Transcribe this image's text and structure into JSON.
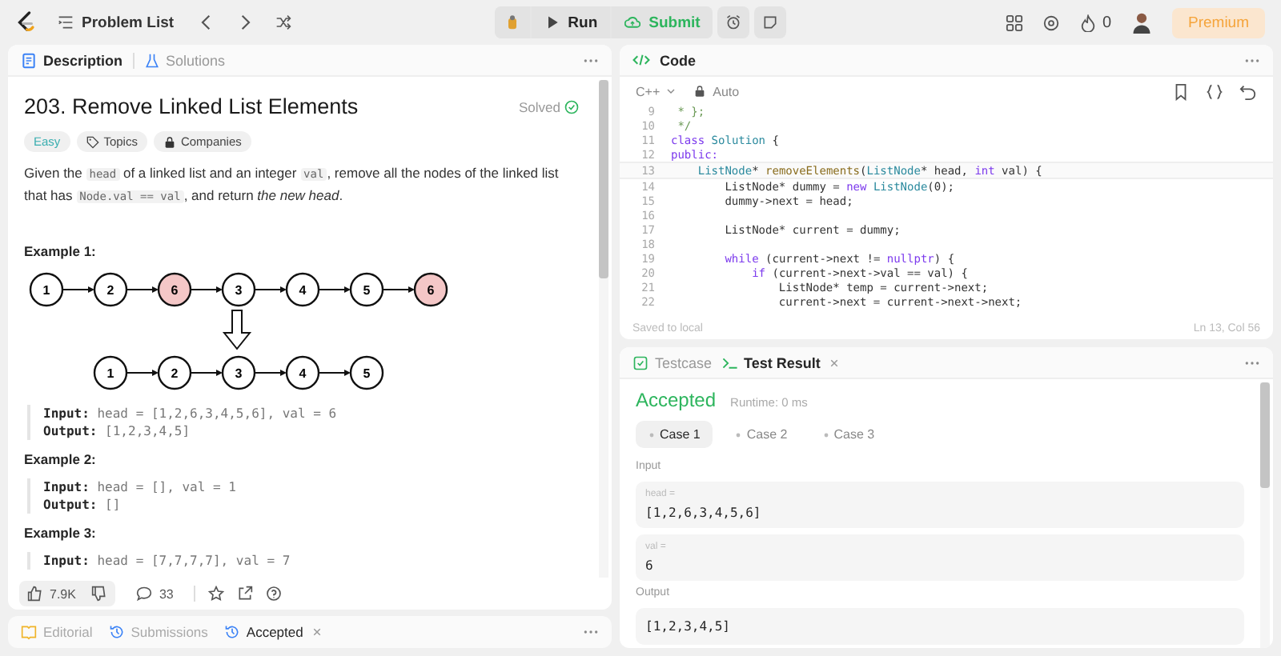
{
  "topbar": {
    "problem_list": "Problem List",
    "run": "Run",
    "submit": "Submit",
    "streak": "0",
    "premium": "Premium"
  },
  "description_panel": {
    "tabs": [
      {
        "label": "Description",
        "selected": true
      },
      {
        "label": "Solutions",
        "selected": false
      }
    ],
    "title": "203. Remove Linked List Elements",
    "status": "Solved",
    "tags": [
      {
        "label": "Easy",
        "kind": "difficulty"
      },
      {
        "label": "Topics",
        "kind": "topics"
      },
      {
        "label": "Companies",
        "kind": "companies"
      }
    ],
    "statement": [
      {
        "text": "Given the ",
        "kind": "text"
      },
      {
        "text": "head",
        "kind": "code"
      },
      {
        "text": " of a linked list and an integer ",
        "kind": "text"
      },
      {
        "text": "val",
        "kind": "code"
      },
      {
        "text": ", remove all the nodes of the linked list that has ",
        "kind": "text"
      },
      {
        "text": "Node.val == val",
        "kind": "code"
      },
      {
        "text": ", and return ",
        "kind": "text"
      },
      {
        "text": "the new head",
        "kind": "em"
      },
      {
        "text": ".",
        "kind": "text"
      }
    ],
    "examples": [
      {
        "heading": "Example 1:",
        "diagram": {
          "top_row": [
            {
              "label": "1",
              "removed": false
            },
            {
              "label": "2",
              "removed": false
            },
            {
              "label": "6",
              "removed": true
            },
            {
              "label": "3",
              "removed": false
            },
            {
              "label": "4",
              "removed": false
            },
            {
              "label": "5",
              "removed": false
            },
            {
              "label": "6",
              "removed": true
            }
          ],
          "bottom_row": [
            {
              "label": "1",
              "removed": false
            },
            {
              "label": "2",
              "removed": false
            },
            {
              "label": "3",
              "removed": false
            },
            {
              "label": "4",
              "removed": false
            },
            {
              "label": "5",
              "removed": false
            }
          ]
        },
        "lines": [
          {
            "label": "Input:",
            "value": "head = [1,2,6,3,4,5,6], val = 6"
          },
          {
            "label": "Output:",
            "value": "[1,2,3,4,5]"
          }
        ]
      },
      {
        "heading": "Example 2:",
        "lines": [
          {
            "label": "Input:",
            "value": "head = [], val = 1"
          },
          {
            "label": "Output:",
            "value": "[]"
          }
        ]
      },
      {
        "heading": "Example 3:",
        "lines": [
          {
            "label": "Input:",
            "value": "head = [7,7,7,7], val = 7"
          }
        ]
      }
    ],
    "actions": {
      "likes": "7.9K",
      "comments": "33"
    },
    "bottom_tabs": [
      {
        "label": "Editorial",
        "selected": false,
        "closable": false
      },
      {
        "label": "Submissions",
        "selected": false,
        "closable": false
      },
      {
        "label": "Accepted",
        "selected": true,
        "closable": true
      }
    ]
  },
  "code_panel": {
    "title": "Code",
    "language": "C++",
    "mode": "Auto",
    "lines": [
      {
        "num": "9",
        "segs": [
          {
            "text": " * };",
            "kind": "comment"
          }
        ]
      },
      {
        "num": "10",
        "segs": [
          {
            "text": " */",
            "kind": "comment"
          }
        ]
      },
      {
        "num": "11",
        "segs": [
          {
            "text": "class ",
            "kind": "kw"
          },
          {
            "text": "Solution",
            "kind": "type"
          },
          {
            "text": " {",
            "kind": "plain"
          }
        ]
      },
      {
        "num": "12",
        "segs": [
          {
            "text": "public:",
            "kind": "kw"
          }
        ]
      },
      {
        "num": "13",
        "segs": [
          {
            "text": "    ListNode",
            "kind": "type"
          },
          {
            "text": "* ",
            "kind": "plain"
          },
          {
            "text": "removeElements",
            "kind": "fn"
          },
          {
            "text": "(",
            "kind": "plain"
          },
          {
            "text": "ListNode",
            "kind": "type"
          },
          {
            "text": "* head, ",
            "kind": "plain"
          },
          {
            "text": "int",
            "kind": "kw"
          },
          {
            "text": " val) {",
            "kind": "plain"
          }
        ]
      },
      {
        "num": "14",
        "segs": [
          {
            "text": "        ListNode* dummy = ",
            "kind": "plain"
          },
          {
            "text": "new ",
            "kind": "kw"
          },
          {
            "text": "ListNode",
            "kind": "type"
          },
          {
            "text": "(0);",
            "kind": "plain"
          }
        ]
      },
      {
        "num": "15",
        "segs": [
          {
            "text": "        dummy->next = head;",
            "kind": "plain"
          }
        ]
      },
      {
        "num": "16"
      },
      {
        "num": "17",
        "segs": [
          {
            "text": "        ListNode* current = dummy;",
            "kind": "plain"
          }
        ]
      },
      {
        "num": "18"
      },
      {
        "num": "19",
        "segs": [
          {
            "text": "        while",
            "kind": "kw"
          },
          {
            "text": " (current->next != ",
            "kind": "plain"
          },
          {
            "text": "nullptr",
            "kind": "kw"
          },
          {
            "text": ") {",
            "kind": "plain"
          }
        ]
      },
      {
        "num": "20",
        "segs": [
          {
            "text": "            if",
            "kind": "kw"
          },
          {
            "text": " (current->next->val == val) {",
            "kind": "plain"
          }
        ]
      },
      {
        "num": "21",
        "segs": [
          {
            "text": "                ListNode* temp = current->next;",
            "kind": "plain"
          }
        ]
      },
      {
        "num": "22",
        "segs": [
          {
            "text": "                current->next = current->next->next;",
            "kind": "plain"
          }
        ]
      }
    ],
    "saved": "Saved to local",
    "cursor": "Ln 13, Col 56"
  },
  "result_panel": {
    "tabs": [
      {
        "label": "Testcase",
        "selected": false,
        "closable": false
      },
      {
        "label": "Test Result",
        "selected": true,
        "closable": true
      }
    ],
    "verdict": "Accepted",
    "runtime": "Runtime: 0 ms",
    "cases": [
      {
        "label": "Case 1",
        "selected": true
      },
      {
        "label": "Case 2",
        "selected": false
      },
      {
        "label": "Case 3",
        "selected": false
      }
    ],
    "input_heading": "Input",
    "inputs": [
      {
        "name": "head =",
        "value": "[1,2,6,3,4,5,6]"
      },
      {
        "name": "val =",
        "value": "6"
      }
    ],
    "output_heading": "Output",
    "output": "[1,2,3,4,5]"
  }
}
